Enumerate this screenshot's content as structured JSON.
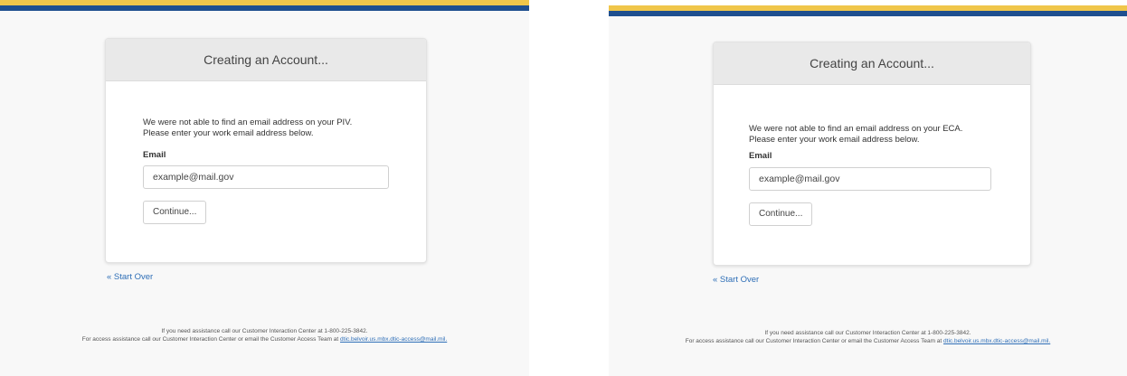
{
  "panels": [
    {
      "card_title": "Creating an Account...",
      "message_line1": "We were not able to find an email address on your PIV.",
      "message_line2": "Please enter your work email address below.",
      "email_label": "Email",
      "email_placeholder": "example@mail.gov",
      "continue_label": "Continue...",
      "start_over_label": "« Start Over",
      "footer_line1": "If you need assistance call our Customer Interaction Center at 1-800-225-3842.",
      "footer_line2_prefix": "For access assistance call our Customer Interaction Center or email the Customer Access Team at",
      "footer_email": "dtic.belvoir.us.mbx.dtic-access@mail.mil."
    },
    {
      "card_title": "Creating an Account...",
      "message_line1": "We were not able to find an email address on your ECA.",
      "message_line2": "Please enter your work email address below.",
      "email_label": "Email",
      "email_placeholder": "example@mail.gov",
      "continue_label": "Continue...",
      "start_over_label": "« Start Over",
      "footer_line1": "If you need assistance call our Customer Interaction Center at 1-800-225-3842.",
      "footer_line2_prefix": "For access assistance call our Customer Interaction Center or email the Customer Access Team at",
      "footer_email": "dtic.belvoir.us.mbx.dtic-access@mail.mil."
    }
  ],
  "colors": {
    "gold_bar": "#f0c64a",
    "blue_bar": "#1f4f8f",
    "link": "#2f6fb7"
  }
}
